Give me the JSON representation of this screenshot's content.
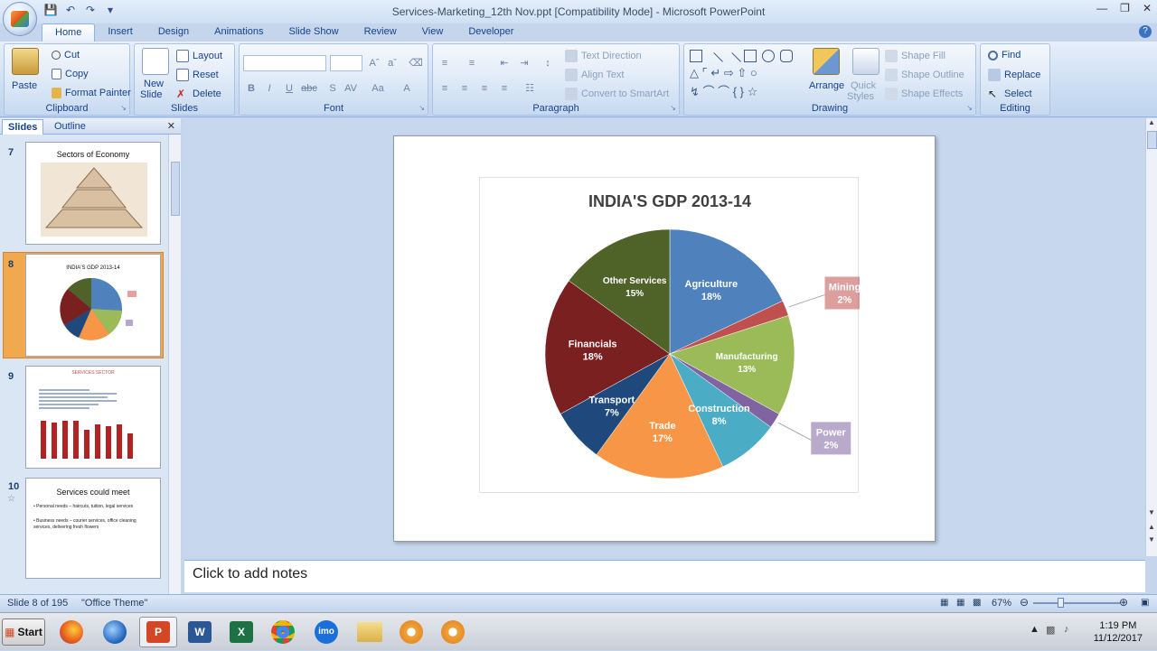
{
  "window": {
    "title": "Services-Marketing_12th Nov.ppt [Compatibility Mode] - Microsoft PowerPoint"
  },
  "tabs": [
    "Home",
    "Insert",
    "Design",
    "Animations",
    "Slide Show",
    "Review",
    "View",
    "Developer"
  ],
  "ribbon": {
    "clipboard": {
      "label": "Clipboard",
      "paste": "Paste",
      "cut": "Cut",
      "copy": "Copy",
      "format_painter": "Format Painter"
    },
    "slides": {
      "label": "Slides",
      "new_slide_1": "New",
      "new_slide_2": "Slide",
      "layout": "Layout",
      "reset": "Reset",
      "delete": "Delete"
    },
    "font": {
      "label": "Font"
    },
    "paragraph": {
      "label": "Paragraph",
      "text_direction": "Text Direction",
      "align_text": "Align Text",
      "convert_smartart": "Convert to SmartArt"
    },
    "drawing": {
      "label": "Drawing",
      "arrange": "Arrange",
      "quick_styles_1": "Quick",
      "quick_styles_2": "Styles",
      "shape_fill": "Shape Fill",
      "shape_outline": "Shape Outline",
      "shape_effects": "Shape Effects"
    },
    "editing": {
      "label": "Editing",
      "find": "Find",
      "replace": "Replace",
      "select": "Select"
    }
  },
  "left_pane": {
    "tab_slides": "Slides",
    "tab_outline": "Outline",
    "thumbnails": [
      {
        "num": "7",
        "title": "Sectors of Economy"
      },
      {
        "num": "8",
        "title": "INDIA'S GDP 2013-14"
      },
      {
        "num": "9",
        "title": "SERVICES SECTOR"
      },
      {
        "num": "10",
        "title": "Services could meet",
        "bullets": [
          "Personal needs – haircuts, tuition, legal services",
          "Business needs – courier services, office cleaning services, delivering fresh flowers"
        ]
      }
    ]
  },
  "chart_data": {
    "type": "pie",
    "title": "INDIA'S GDP 2013-14",
    "slices": [
      {
        "label": "Agriculture",
        "value": 18,
        "color": "#4f81bd"
      },
      {
        "label": "Mining",
        "value": 2,
        "color": "#c0504d"
      },
      {
        "label": "Manufacturing",
        "value": 13,
        "color": "#9bbb59"
      },
      {
        "label": "Power",
        "value": 2,
        "color": "#8064a2"
      },
      {
        "label": "Construction",
        "value": 8,
        "color": "#4bacc6"
      },
      {
        "label": "Trade",
        "value": 17,
        "color": "#f79646"
      },
      {
        "label": "Transport",
        "value": 7,
        "color": "#1f497d"
      },
      {
        "label": "Financials",
        "value": 18,
        "color": "#7b2020"
      },
      {
        "label": "Other Services",
        "value": 15,
        "color": "#4f6228"
      }
    ]
  },
  "notes": {
    "placeholder": "Click to add notes"
  },
  "status": {
    "slide_info": "Slide 8 of 195",
    "theme": "\"Office Theme\"",
    "zoom": "67%"
  },
  "taskbar": {
    "start": "Start",
    "imo": "imo",
    "time": "1:19 PM",
    "date": "11/12/2017"
  }
}
